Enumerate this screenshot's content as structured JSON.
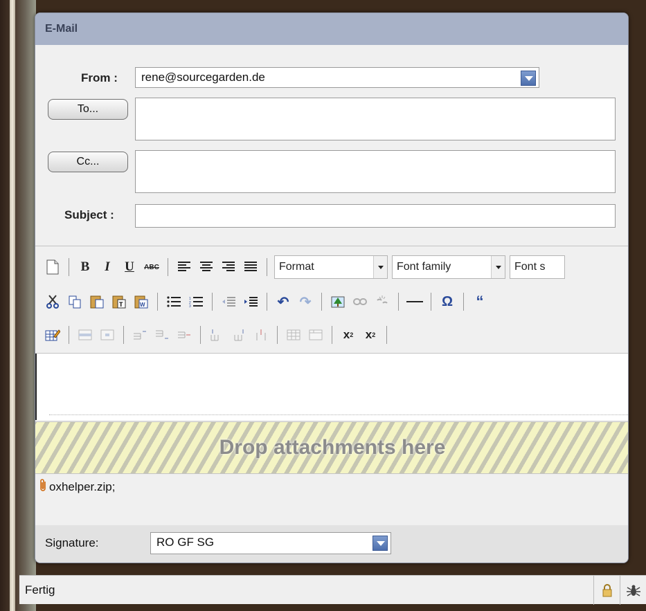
{
  "window": {
    "title": "E-Mail"
  },
  "form": {
    "from_label": "From :",
    "from_value": "rene@sourcegarden.de",
    "to_button": "To...",
    "to_value": "",
    "cc_button": "Cc...",
    "cc_value": "",
    "subject_label": "Subject :",
    "subject_value": ""
  },
  "toolbar": {
    "format_label": "Format",
    "font_family_label": "Font family",
    "font_size_label": "Font s"
  },
  "dropzone": {
    "text": "Drop attachments here"
  },
  "attachments": {
    "files": "oxhelper.zip;"
  },
  "signature": {
    "label": "Signature:",
    "value": "RO GF SG"
  },
  "statusbar": {
    "text": "Fertig"
  },
  "colors": {
    "titlebar": "#a8b2c8",
    "dropdown_arrow": "#4d6fad"
  }
}
